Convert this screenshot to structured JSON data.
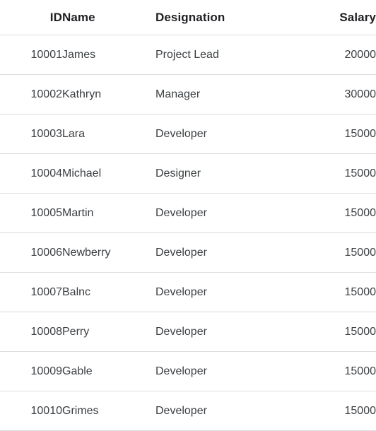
{
  "table": {
    "columns": [
      {
        "key": "id",
        "label": "ID",
        "align": "right"
      },
      {
        "key": "name",
        "label": "Name",
        "align": "left"
      },
      {
        "key": "designation",
        "label": "Designation",
        "align": "left"
      },
      {
        "key": "salary",
        "label": "Salary",
        "align": "right"
      }
    ],
    "rows": [
      {
        "id": "10001",
        "name": "James",
        "designation": "Project Lead",
        "salary": "20000"
      },
      {
        "id": "10002",
        "name": "Kathryn",
        "designation": "Manager",
        "salary": "30000"
      },
      {
        "id": "10003",
        "name": "Lara",
        "designation": "Developer",
        "salary": "15000"
      },
      {
        "id": "10004",
        "name": "Michael",
        "designation": "Designer",
        "salary": "15000"
      },
      {
        "id": "10005",
        "name": "Martin",
        "designation": "Developer",
        "salary": "15000"
      },
      {
        "id": "10006",
        "name": "Newberry",
        "designation": "Developer",
        "salary": "15000"
      },
      {
        "id": "10007",
        "name": "Balnc",
        "designation": "Developer",
        "salary": "15000"
      },
      {
        "id": "10008",
        "name": "Perry",
        "designation": "Developer",
        "salary": "15000"
      },
      {
        "id": "10009",
        "name": "Gable",
        "designation": "Developer",
        "salary": "15000"
      },
      {
        "id": "10010",
        "name": "Grimes",
        "designation": "Developer",
        "salary": "15000"
      }
    ]
  },
  "colors": {
    "background": "#ffffff",
    "header_text": "#202124",
    "body_text": "#3c4043",
    "divider": "#dadce0"
  }
}
